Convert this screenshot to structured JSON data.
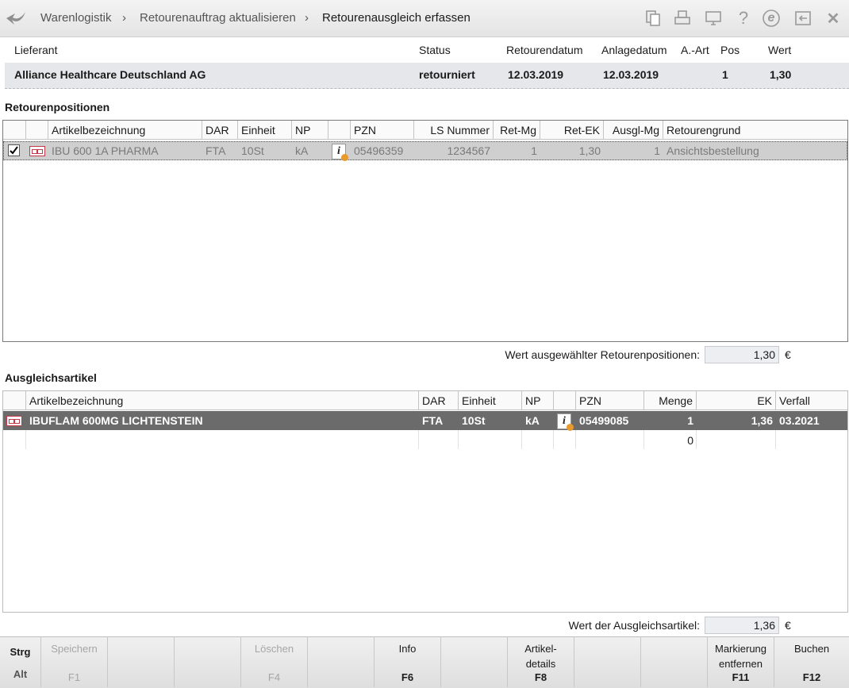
{
  "breadcrumb": {
    "items": [
      "Warenlogistik",
      "Retourenauftrag aktualisieren",
      "Retourenausgleich erfassen"
    ],
    "separator": "›"
  },
  "toolbar_icons": [
    "back-arrow-icon",
    "copy-document-icon",
    "print-icon",
    "monitor-icon",
    "help-icon",
    "e-icon",
    "exit-window-icon",
    "close-icon"
  ],
  "toolbar_glyphs": {
    "help": "?",
    "e": "e",
    "close": "✕"
  },
  "header": {
    "labels": {
      "lieferant": "Lieferant",
      "status": "Status",
      "retourendatum": "Retourendatum",
      "anlagedatum": "Anlagedatum",
      "aart": "A.-Art",
      "pos": "Pos",
      "wert": "Wert"
    },
    "values": {
      "lieferant": "Alliance Healthcare Deutschland AG",
      "status": "retourniert",
      "retourendatum": "12.03.2019",
      "anlagedatum": "12.03.2019",
      "aart": "",
      "pos": "1",
      "wert": "1,30"
    }
  },
  "retourenpositionen": {
    "title": "Retourenpositionen",
    "columns": [
      "Artikelbezeichnung",
      "DAR",
      "Einheit",
      "NP",
      "PZN",
      "LS Nummer",
      "Ret-Mg",
      "Ret-EK",
      "Ausgl-Mg",
      "Retourengrund"
    ],
    "rows": [
      {
        "checked": true,
        "artikel": "IBU 600 1A PHARMA",
        "dar": "FTA",
        "einheit": "10St",
        "np": "kA",
        "pzn": "05496359",
        "ls": "1234567",
        "retmg": "1",
        "retek": "1,30",
        "ausglmg": "1",
        "grund": "Ansichtsbestellung"
      }
    ],
    "sum_label": "Wert ausgewählter Retourenpositionen:",
    "sum_value": "1,30",
    "currency": "€"
  },
  "ausgleichsartikel": {
    "title": "Ausgleichsartikel",
    "columns": [
      "Artikelbezeichnung",
      "DAR",
      "Einheit",
      "NP",
      "PZN",
      "Menge",
      "EK",
      "Verfall"
    ],
    "rows": [
      {
        "artikel": "IBUFLAM 600MG LICHTENSTEIN",
        "dar": "FTA",
        "einheit": "10St",
        "np": "kA",
        "pzn": "05499085",
        "menge": "1",
        "ek": "1,36",
        "verfall": "03.2021"
      }
    ],
    "new_row_menge": "0",
    "sum_label": "Wert der Ausgleichsartikel:",
    "sum_value": "1,36",
    "currency": "€"
  },
  "function_keys": {
    "strg": "Strg",
    "alt": "Alt",
    "speichern": {
      "label": "Speichern",
      "key": "F1"
    },
    "loeschen": {
      "label": "Löschen",
      "key": "F4"
    },
    "info": {
      "label": "Info",
      "key": "F6"
    },
    "artikeldetails": {
      "label1": "Artikel-",
      "label2": "details",
      "key": "F8"
    },
    "markierung": {
      "label1": "Markierung",
      "label2": "entfernen",
      "key": "F11"
    },
    "buchen": {
      "label": "Buchen",
      "key": "F12"
    }
  },
  "colors": {
    "accent": "#c23a4a",
    "selected_row": "#6b6b6b",
    "checked_row": "#cfcfcf",
    "info_dot": "#e89a2c"
  }
}
